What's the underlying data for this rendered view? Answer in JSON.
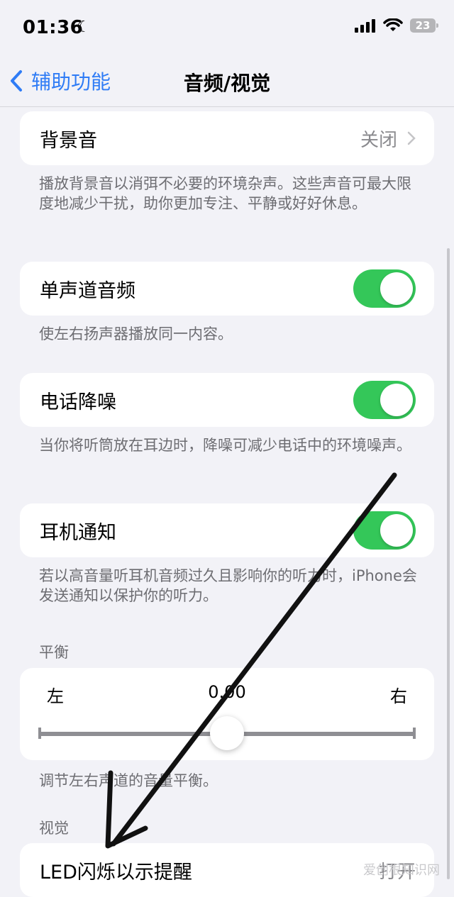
{
  "status_bar": {
    "time": "01:36",
    "battery": "23"
  },
  "nav": {
    "back_label": "辅助功能",
    "title": "音频/视觉"
  },
  "background_sound": {
    "label": "背景音",
    "value": "关闭",
    "footer": "播放背景音以消弭不必要的环境杂声。这些声音可最大限度地减少干扰，助你更加专注、平静或好好休息。"
  },
  "mono_audio": {
    "label": "单声道音频",
    "on": true,
    "footer": "使左右扬声器播放同一内容。"
  },
  "phone_noise": {
    "label": "电话降噪",
    "on": true,
    "footer": "当你将听筒放在耳边时，降噪可减少电话中的环境噪声。"
  },
  "headphone_notif": {
    "label": "耳机通知",
    "on": true,
    "footer": "若以高音量听耳机音频过久且影响你的听力时，iPhone会发送通知以保护你的听力。"
  },
  "balance": {
    "header": "平衡",
    "left": "左",
    "right": "右",
    "value": "0.00",
    "position": 0.5,
    "footer": "调节左右声道的音量平衡。"
  },
  "visual": {
    "header": "视觉"
  },
  "led_flash": {
    "label": "LED闪烁以示提醒",
    "value": "打开"
  },
  "watermark": "爱创根知识网",
  "colors": {
    "accent": "#2f7cf6",
    "toggle_on": "#34c759"
  }
}
